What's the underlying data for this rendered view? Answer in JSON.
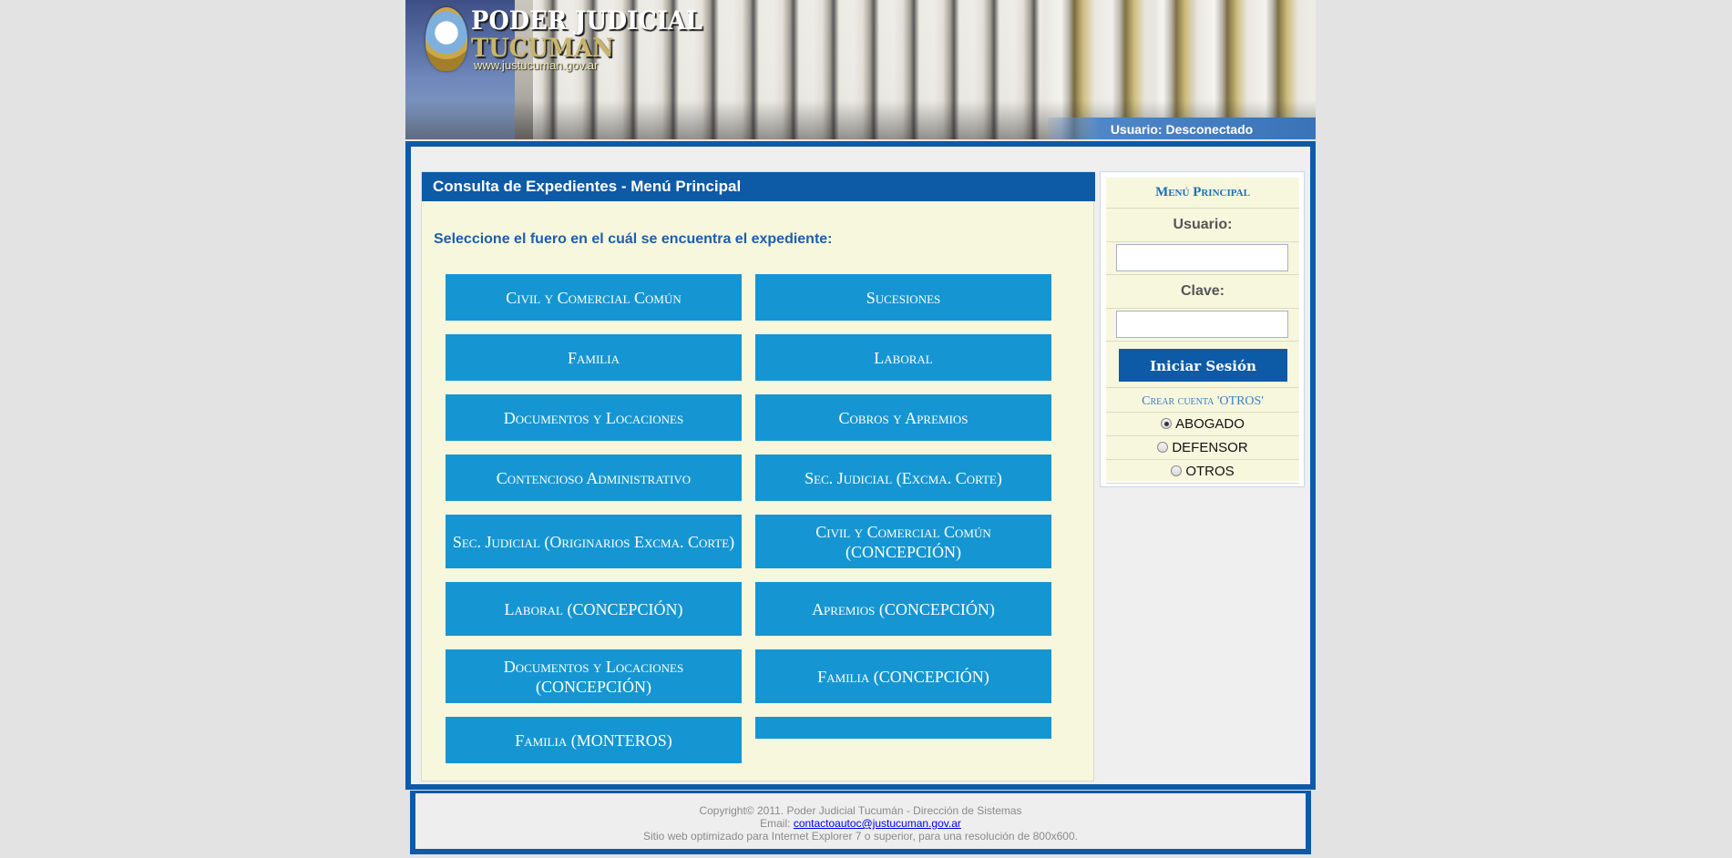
{
  "header": {
    "logo_title": "PODER JUDICIAL",
    "logo_subtitle": "TUCUMAN",
    "logo_url": "www.justucuman.gov.ar",
    "user_status": "Usuario: Desconectado"
  },
  "content": {
    "title": "Consulta de Expedientes - Menú Principal",
    "prompt": "Seleccione el fuero en el cuál se encuentra el expediente:",
    "fueros": [
      "Civil y Comercial Común",
      "Sucesiones",
      "Familia",
      "Laboral",
      "Documentos y Locaciones",
      "Cobros y Apremios",
      "Contencioso Administrativo",
      "Sec. Judicial (Excma. Corte)",
      "Sec. Judicial (Originarios Excma. Corte)",
      "Civil y Comercial Común (CONCEPCIÓN)",
      "Laboral (CONCEPCIÓN)",
      "Apremios (CONCEPCIÓN)",
      "Documentos y Locaciones (CONCEPCIÓN)",
      "Familia (CONCEPCIÓN)",
      "Familia (MONTEROS)",
      ""
    ]
  },
  "sidebar": {
    "menu_title": "Menú Principal",
    "user_label": "Usuario:",
    "user_value": "",
    "password_label": "Clave:",
    "password_value": "",
    "login_button": "Iniciar Sesión",
    "create_account": "Crear cuenta 'OTROS'",
    "account_types": [
      {
        "label": "ABOGADO",
        "checked": true
      },
      {
        "label": "DEFENSOR",
        "checked": false
      },
      {
        "label": "OTROS",
        "checked": false
      }
    ]
  },
  "footer": {
    "copyright": "Copyright© 2011. Poder Judicial Tucumán - Dirección de Sistemas",
    "email_label": "Email: ",
    "email": "contactoautoc@justucuman.gov.ar",
    "note": "Sitio web optimizado para Internet Explorer 7 o superior, para una resolución de 800x600."
  },
  "colors": {
    "brand_blue": "#0d5aa7",
    "button_blue": "#1596d2",
    "panel_bg": "#f7f7de"
  }
}
